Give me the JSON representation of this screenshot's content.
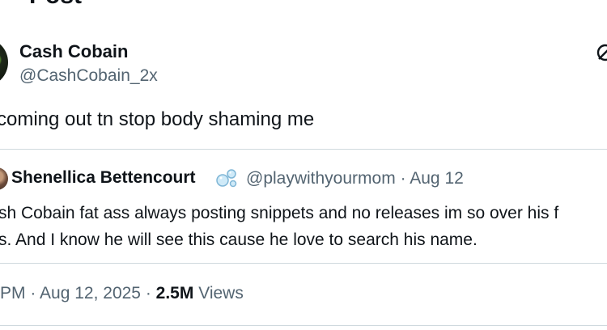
{
  "header": {
    "title": "Post"
  },
  "post": {
    "author": {
      "name": "Cash Cobain",
      "handle": "@CashCobain_2x"
    },
    "text": "coming out tn stop body shaming me",
    "quote": {
      "author_name": "Shenellica Bettencourt",
      "author_emoji": "bubbles-icon",
      "handle": "@playwithyourmom",
      "separator": "·",
      "date": "Aug 12",
      "text_line_1": "sh Cobain fat ass always posting snippets and no releases im so over his f",
      "text_line_2": "s. And I know he will see this cause he love to search his name."
    },
    "timestamp": {
      "time": "PM",
      "separator_1": "·",
      "date": "Aug 12, 2025",
      "separator_2": "·",
      "views_count": "2.5M",
      "views_label": "Views"
    }
  },
  "colors": {
    "text_primary": "#0f1419",
    "text_secondary": "#536471",
    "divider": "#cfd9de"
  }
}
